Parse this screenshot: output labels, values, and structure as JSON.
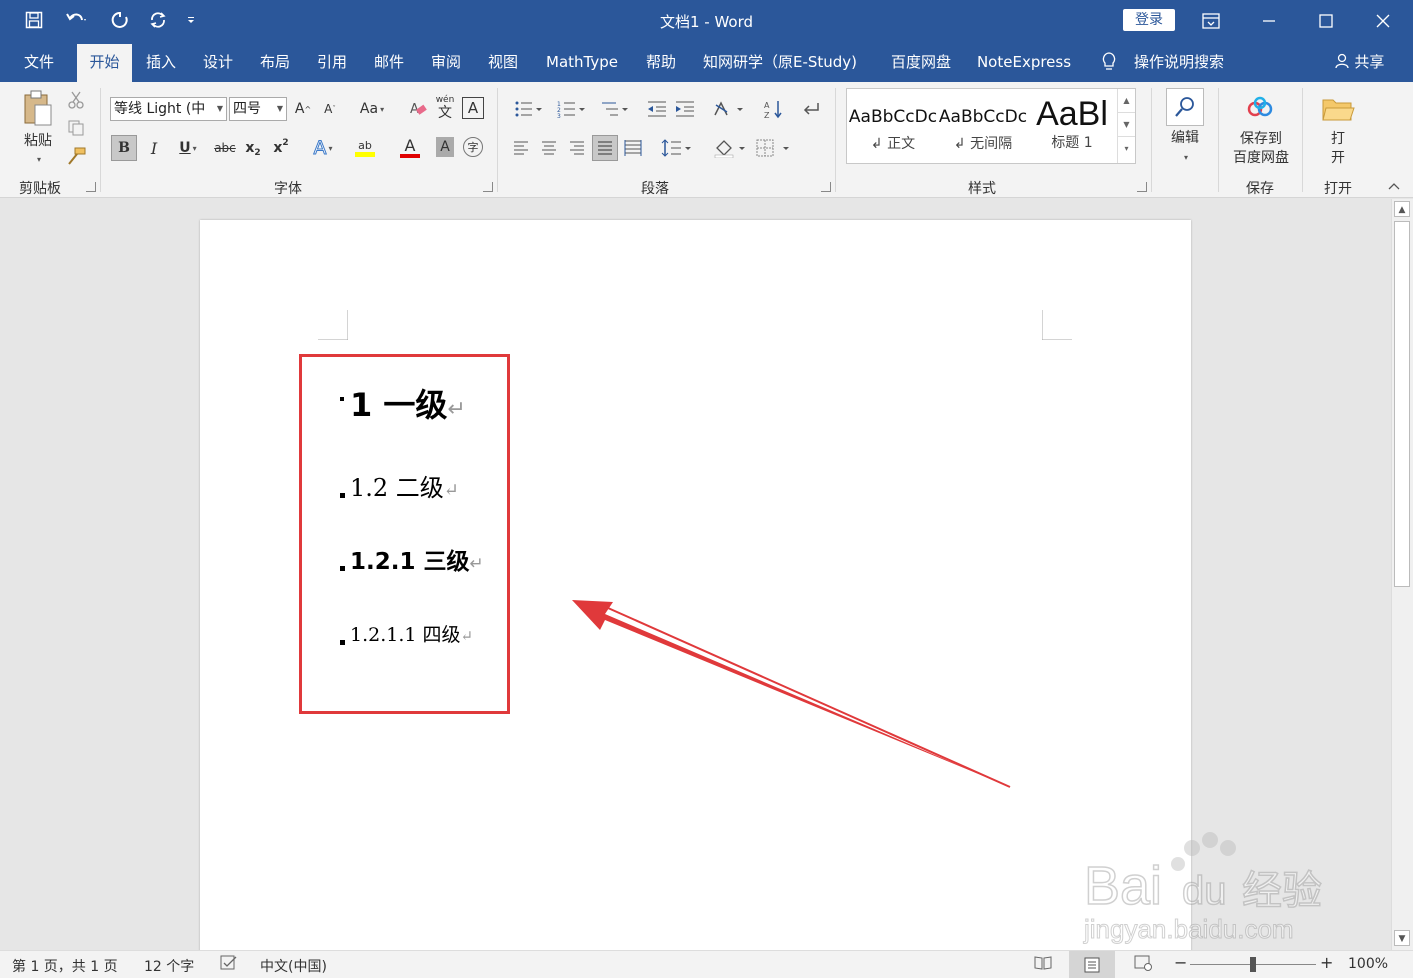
{
  "window": {
    "title": "文档1  -  Word",
    "login_label": "登录"
  },
  "tabs": [
    {
      "label": "文件"
    },
    {
      "label": "开始",
      "active": true
    },
    {
      "label": "插入"
    },
    {
      "label": "设计"
    },
    {
      "label": "布局"
    },
    {
      "label": "引用"
    },
    {
      "label": "邮件"
    },
    {
      "label": "审阅"
    },
    {
      "label": "视图"
    },
    {
      "label": "MathType"
    },
    {
      "label": "帮助"
    },
    {
      "label": "知网研学（原E-Study)"
    },
    {
      "label": "百度网盘"
    },
    {
      "label": "NoteExpress"
    },
    {
      "label": "操作说明搜索"
    }
  ],
  "share_label": "共享",
  "ribbon": {
    "clipboard": {
      "group_label": "剪贴板",
      "paste_label": "粘贴"
    },
    "font": {
      "group_label": "字体",
      "font_name": "等线 Light (中",
      "font_size": "四号",
      "grow_label": "A",
      "shrink_label": "A",
      "case_label": "Aa",
      "border_char_label": "A",
      "bold_label": "B",
      "italic_label": "I",
      "underline_label": "U",
      "strike_label": "abc",
      "subscript_label": "x",
      "subscript_mark": "2",
      "superscript_label": "x",
      "superscript_mark": "2",
      "effects_label": "A",
      "highlight_label": "ab",
      "font_color_label": "A",
      "shade_label": "A",
      "enclose_label": "字",
      "phonetic_label": "wén",
      "phonetic_char": "文"
    },
    "paragraph": {
      "group_label": "段落"
    },
    "styles": {
      "group_label": "样式",
      "items": [
        {
          "sample": "AaBbCcDc",
          "name": "↲ 正文"
        },
        {
          "sample": "AaBbCcDc",
          "name": "↲ 无间隔"
        },
        {
          "sample": "AaBl",
          "name": "标题 1"
        }
      ]
    },
    "editing": {
      "label": "编辑"
    },
    "save": {
      "button_line1": "保存到",
      "button_line2": "百度网盘",
      "group_label": "保存"
    },
    "open": {
      "button_line1": "打",
      "button_line2": "开",
      "group_label": "打开"
    }
  },
  "document": {
    "headings": [
      {
        "level": 1,
        "text": "1  一级"
      },
      {
        "level": 2,
        "text": "1.2  二级"
      },
      {
        "level": 3,
        "text": "1.2.1  三级"
      },
      {
        "level": 4,
        "text": "1.2.1.1  四级"
      }
    ],
    "pilcrow": "↵",
    "highlight_color": "#e0393b",
    "arrow_color": "#e0393b"
  },
  "statusbar": {
    "page_info": "第 1 页，共 1 页",
    "word_count": "12 个字",
    "language": "中文(中国)",
    "zoom_minus": "−",
    "zoom_plus": "+",
    "zoom": "100%"
  },
  "colors": {
    "brand": "#2b579a",
    "ribbon_bg": "#f3f3f3",
    "highlight_yellow": "#ffff00",
    "font_red": "#e00000"
  },
  "watermark": {
    "text": "Bai",
    "brand": "du",
    "suffix": "经验",
    "url": "jingyan.baidu.com"
  }
}
